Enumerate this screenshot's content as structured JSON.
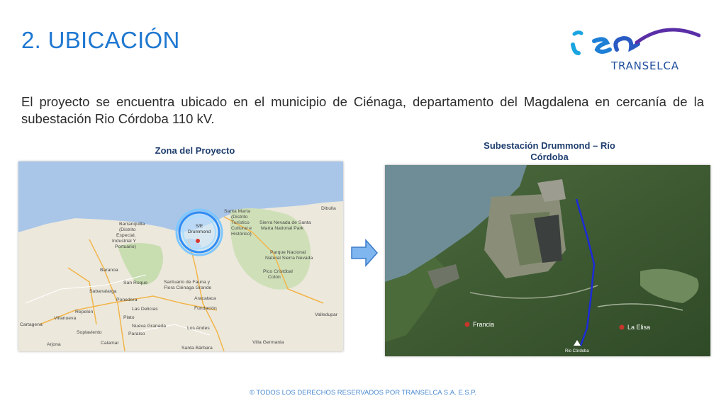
{
  "slide": {
    "title": "2. UBICACIÓN",
    "logo_subtitle": "TRANSELCA",
    "body": "El proyecto se encuentra ubicado en el municipio de Ciénaga, departamento del Magdalena en cercanía de la subestación Rio Córdoba 110 kV.",
    "footer": "© TODOS LOS DERECHOS RESERVADOS POR TRANSELCA S.A. E.S.P."
  },
  "left_map": {
    "caption": "Zona del Proyecto",
    "marker_label_1": "S/E",
    "marker_label_2": "Drummond",
    "labels": {
      "santa_marta": "Santa Marta",
      "distrito": "(Distrito",
      "turistico": "Turístico",
      "cultural": "Cultural e",
      "historico": "Histórico)",
      "barranquilla": "Barranquilla",
      "distrito2": "(Distrito",
      "especial": "Especial,",
      "industrial": "Industrial Y",
      "portuario": "Portuario)",
      "baranoa": "Baranoa",
      "sabanalarga": "Sabanalarga",
      "san_roque": "San Roque",
      "ponedera": "Ponedera",
      "repelon": "Repelón",
      "villanueva": "Villanueva",
      "cartagena": "Cartagena",
      "sopla": "Soplaviento",
      "arjona": "Arjona",
      "calamar": "Calamar",
      "las_delicias": "Las Delicias",
      "plato": "Plato",
      "paraiso": "Paraíso",
      "fundacion": "Fundación",
      "aracataca": "Aracataca",
      "los_andes": "Los Andes",
      "santuario": "Santuario de Fauna y",
      "cienaga": "Flora Ciénaga Grande",
      "sierra": "Sierra Nevada de Santa",
      "marta_np": "Marta National Park",
      "parque": "Parque Nacional",
      "natural": "Natural Sierra Nevada",
      "pico": "Pico Cristóbal",
      "colon": "Colón",
      "dibulla": "Dibulla",
      "valledupar": "Valledupar",
      "villa_germania": "Villa Germania",
      "santa_barbara": "Santa Bárbara",
      "nueva": "Nueva Granada"
    }
  },
  "right_map": {
    "caption": "Subestación Drummond – Río Córdoba",
    "francia": "Francia",
    "la_elisa": "La Elisa",
    "rio_cordoba": "Rio Córdoba"
  },
  "colors": {
    "title": "#1f78d1",
    "caption": "#1f3e6e",
    "arrow_fill": "#7fb6f0",
    "route_line": "#1b2bd8"
  }
}
